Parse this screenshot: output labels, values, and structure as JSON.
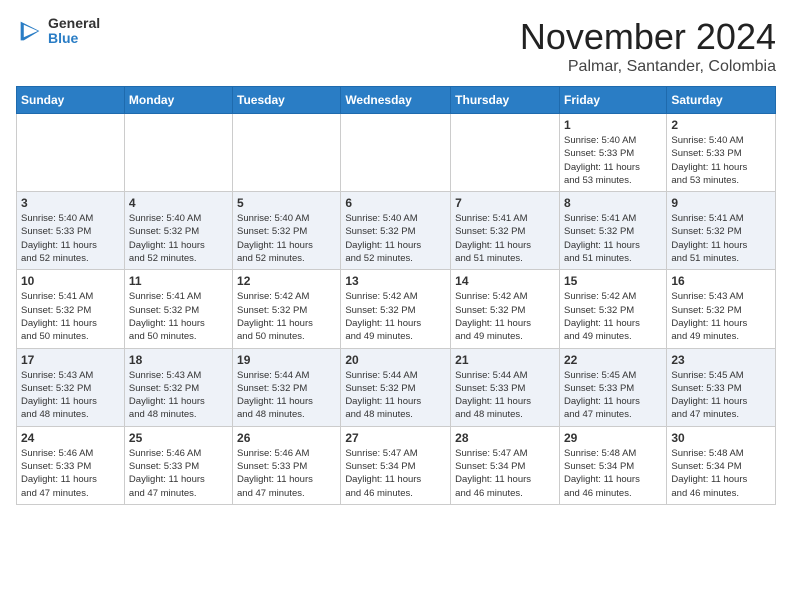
{
  "header": {
    "logo_line1": "General",
    "logo_line2": "Blue",
    "month": "November 2024",
    "location": "Palmar, Santander, Colombia"
  },
  "weekdays": [
    "Sunday",
    "Monday",
    "Tuesday",
    "Wednesday",
    "Thursday",
    "Friday",
    "Saturday"
  ],
  "weeks": [
    [
      {
        "day": "",
        "info": ""
      },
      {
        "day": "",
        "info": ""
      },
      {
        "day": "",
        "info": ""
      },
      {
        "day": "",
        "info": ""
      },
      {
        "day": "",
        "info": ""
      },
      {
        "day": "1",
        "info": "Sunrise: 5:40 AM\nSunset: 5:33 PM\nDaylight: 11 hours\nand 53 minutes."
      },
      {
        "day": "2",
        "info": "Sunrise: 5:40 AM\nSunset: 5:33 PM\nDaylight: 11 hours\nand 53 minutes."
      }
    ],
    [
      {
        "day": "3",
        "info": "Sunrise: 5:40 AM\nSunset: 5:33 PM\nDaylight: 11 hours\nand 52 minutes."
      },
      {
        "day": "4",
        "info": "Sunrise: 5:40 AM\nSunset: 5:32 PM\nDaylight: 11 hours\nand 52 minutes."
      },
      {
        "day": "5",
        "info": "Sunrise: 5:40 AM\nSunset: 5:32 PM\nDaylight: 11 hours\nand 52 minutes."
      },
      {
        "day": "6",
        "info": "Sunrise: 5:40 AM\nSunset: 5:32 PM\nDaylight: 11 hours\nand 52 minutes."
      },
      {
        "day": "7",
        "info": "Sunrise: 5:41 AM\nSunset: 5:32 PM\nDaylight: 11 hours\nand 51 minutes."
      },
      {
        "day": "8",
        "info": "Sunrise: 5:41 AM\nSunset: 5:32 PM\nDaylight: 11 hours\nand 51 minutes."
      },
      {
        "day": "9",
        "info": "Sunrise: 5:41 AM\nSunset: 5:32 PM\nDaylight: 11 hours\nand 51 minutes."
      }
    ],
    [
      {
        "day": "10",
        "info": "Sunrise: 5:41 AM\nSunset: 5:32 PM\nDaylight: 11 hours\nand 50 minutes."
      },
      {
        "day": "11",
        "info": "Sunrise: 5:41 AM\nSunset: 5:32 PM\nDaylight: 11 hours\nand 50 minutes."
      },
      {
        "day": "12",
        "info": "Sunrise: 5:42 AM\nSunset: 5:32 PM\nDaylight: 11 hours\nand 50 minutes."
      },
      {
        "day": "13",
        "info": "Sunrise: 5:42 AM\nSunset: 5:32 PM\nDaylight: 11 hours\nand 49 minutes."
      },
      {
        "day": "14",
        "info": "Sunrise: 5:42 AM\nSunset: 5:32 PM\nDaylight: 11 hours\nand 49 minutes."
      },
      {
        "day": "15",
        "info": "Sunrise: 5:42 AM\nSunset: 5:32 PM\nDaylight: 11 hours\nand 49 minutes."
      },
      {
        "day": "16",
        "info": "Sunrise: 5:43 AM\nSunset: 5:32 PM\nDaylight: 11 hours\nand 49 minutes."
      }
    ],
    [
      {
        "day": "17",
        "info": "Sunrise: 5:43 AM\nSunset: 5:32 PM\nDaylight: 11 hours\nand 48 minutes."
      },
      {
        "day": "18",
        "info": "Sunrise: 5:43 AM\nSunset: 5:32 PM\nDaylight: 11 hours\nand 48 minutes."
      },
      {
        "day": "19",
        "info": "Sunrise: 5:44 AM\nSunset: 5:32 PM\nDaylight: 11 hours\nand 48 minutes."
      },
      {
        "day": "20",
        "info": "Sunrise: 5:44 AM\nSunset: 5:32 PM\nDaylight: 11 hours\nand 48 minutes."
      },
      {
        "day": "21",
        "info": "Sunrise: 5:44 AM\nSunset: 5:33 PM\nDaylight: 11 hours\nand 48 minutes."
      },
      {
        "day": "22",
        "info": "Sunrise: 5:45 AM\nSunset: 5:33 PM\nDaylight: 11 hours\nand 47 minutes."
      },
      {
        "day": "23",
        "info": "Sunrise: 5:45 AM\nSunset: 5:33 PM\nDaylight: 11 hours\nand 47 minutes."
      }
    ],
    [
      {
        "day": "24",
        "info": "Sunrise: 5:46 AM\nSunset: 5:33 PM\nDaylight: 11 hours\nand 47 minutes."
      },
      {
        "day": "25",
        "info": "Sunrise: 5:46 AM\nSunset: 5:33 PM\nDaylight: 11 hours\nand 47 minutes."
      },
      {
        "day": "26",
        "info": "Sunrise: 5:46 AM\nSunset: 5:33 PM\nDaylight: 11 hours\nand 47 minutes."
      },
      {
        "day": "27",
        "info": "Sunrise: 5:47 AM\nSunset: 5:34 PM\nDaylight: 11 hours\nand 46 minutes."
      },
      {
        "day": "28",
        "info": "Sunrise: 5:47 AM\nSunset: 5:34 PM\nDaylight: 11 hours\nand 46 minutes."
      },
      {
        "day": "29",
        "info": "Sunrise: 5:48 AM\nSunset: 5:34 PM\nDaylight: 11 hours\nand 46 minutes."
      },
      {
        "day": "30",
        "info": "Sunrise: 5:48 AM\nSunset: 5:34 PM\nDaylight: 11 hours\nand 46 minutes."
      }
    ]
  ]
}
